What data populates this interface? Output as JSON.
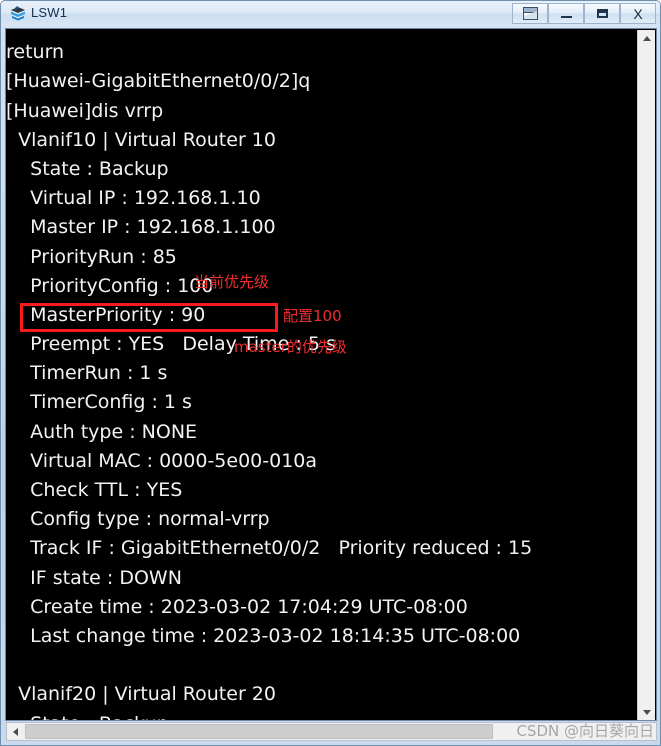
{
  "window": {
    "title": "LSW1",
    "icon": "switch-icon",
    "buttons": [
      {
        "name": "restore-list-button",
        "label": "",
        "icon": "window-list-icon"
      },
      {
        "name": "minimize-button",
        "label": "",
        "icon": "minimize-icon"
      },
      {
        "name": "maximize-button",
        "label": "",
        "icon": "maximize-icon"
      },
      {
        "name": "close-button",
        "label": "X",
        "icon": "close-icon"
      }
    ]
  },
  "terminal": {
    "lines": [
      "#",
      "return",
      "[Huawei-GigabitEthernet0/0/2]q",
      "[Huawei]dis vrrp",
      "  Vlanif10 | Virtual Router 10",
      "    State : Backup",
      "    Virtual IP : 192.168.1.10",
      "    Master IP : 192.168.1.100",
      "    PriorityRun : 85",
      "    PriorityConfig : 100",
      "    MasterPriority : 90",
      "    Preempt : YES   Delay Time : 5 s",
      "    TimerRun : 1 s",
      "    TimerConfig : 1 s",
      "    Auth type : NONE",
      "    Virtual MAC : 0000-5e00-010a",
      "    Check TTL : YES",
      "    Config type : normal-vrrp",
      "    Track IF : GigabitEthernet0/0/2   Priority reduced : 15",
      "    IF state : DOWN",
      "    Create time : 2023-03-02 17:04:29 UTC-08:00",
      "    Last change time : 2023-03-02 18:14:35 UTC-08:00",
      "",
      "  Vlanif20 | Virtual Router 20",
      "    State : Backup"
    ]
  },
  "annotations": {
    "priority_run_note": "当前优先级",
    "priority_config_note": "配置100",
    "master_priority_note": "master的优先级",
    "highlight_color": "#fb1b1b"
  },
  "scrollbars": {
    "vertical_up": "▲",
    "vertical_down": "▼",
    "horizontal_left": "◄"
  },
  "watermark": "CSDN @向日葵向日"
}
